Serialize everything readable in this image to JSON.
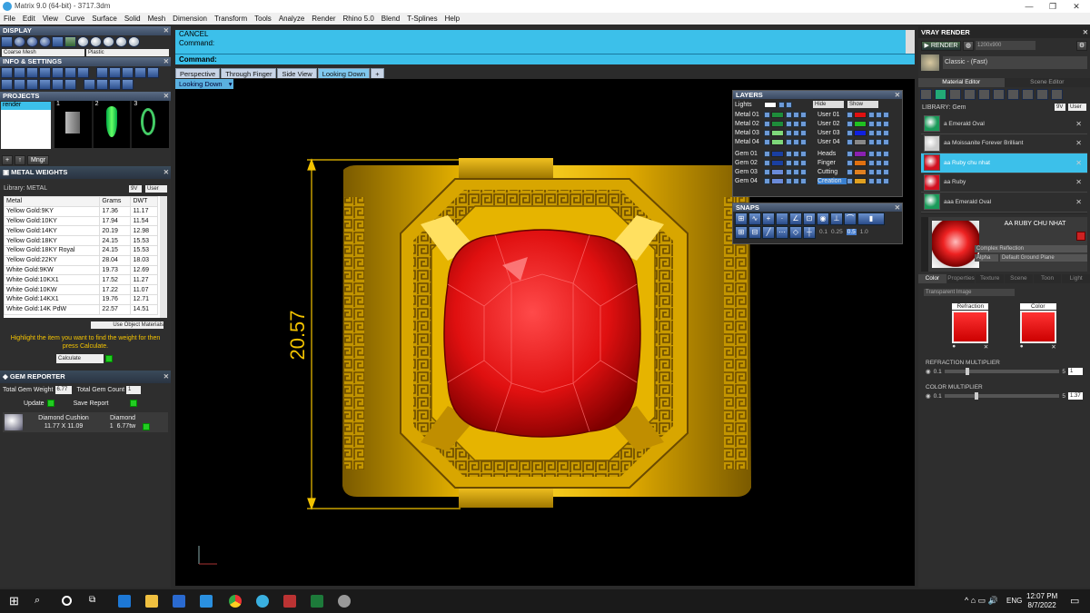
{
  "window": {
    "title": "Matrix 9.0 (64-bit) - 3717.3dm"
  },
  "menu": [
    "File",
    "Edit",
    "View",
    "Curve",
    "Surface",
    "Solid",
    "Mesh",
    "Dimension",
    "Transform",
    "Tools",
    "Analyze",
    "Render",
    "Rhino 5.0",
    "Blend",
    "T-Splines",
    "Help"
  ],
  "display": {
    "title": "DISPLAY",
    "left_select": "Coarse Mesh",
    "right_select": "Plastic"
  },
  "info": {
    "title": "INFO & SETTINGS"
  },
  "projects": {
    "title": "PROJECTS",
    "item": "render",
    "thumbs": [
      "1",
      "2",
      "3"
    ],
    "buttons": [
      "+",
      "↑",
      "Mngr"
    ]
  },
  "metal": {
    "title": "METAL WEIGHTS",
    "library": "Library: METAL",
    "headers": [
      "Metal",
      "Grams",
      "DWT"
    ],
    "rows": [
      [
        "Yellow Gold:9KY",
        "17.36",
        "11.17"
      ],
      [
        "Yellow Gold:10KY",
        "17.94",
        "11.54"
      ],
      [
        "Yellow Gold:14KY",
        "20.19",
        "12.98"
      ],
      [
        "Yellow Gold:18KY",
        "24.15",
        "15.53"
      ],
      [
        "Yellow Gold:18KY Royal",
        "24.15",
        "15.53"
      ],
      [
        "Yellow Gold:22KY",
        "28.04",
        "18.03"
      ],
      [
        "White Gold:9KW",
        "19.73",
        "12.69"
      ],
      [
        "White Gold:10KX1",
        "17.52",
        "11.27"
      ],
      [
        "White Gold:10KW",
        "17.22",
        "11.07"
      ],
      [
        "White Gold:14KX1",
        "19.76",
        "12.71"
      ],
      [
        "White Gold:14K PdW",
        "22.57",
        "14.51"
      ]
    ],
    "use_object": "Use Object Materials",
    "hint": "Highlight the item you want to find the weight for then press Calculate.",
    "calculate": "Calculate"
  },
  "gem": {
    "title": "GEM REPORTER",
    "total_weight_label": "Total Gem Weight",
    "total_weight": "6.77",
    "total_count_label": "Total Gem Count",
    "total_count": "1",
    "update": "Update",
    "save": "Save Report",
    "item_name": "Diamond Cushion",
    "item_type": "Diamond",
    "item_size": "11.77 X 11.09",
    "item_qty": "1",
    "item_weight": "6.77tw"
  },
  "command": {
    "cancel": "CANCEL",
    "line": "Command:",
    "prompt": "Command:"
  },
  "tabs": [
    "Perspective",
    "Through Finger",
    "Side View",
    "Looking Down"
  ],
  "viewport": {
    "label": "Looking Down",
    "dimension": "20.57"
  },
  "layers": {
    "title": "LAYERS",
    "lights": "Lights",
    "hide": "Hide",
    "show": "Show",
    "left": [
      [
        "Metal 01",
        "#1e8c3a"
      ],
      [
        "Metal 02",
        "#1e8c3a"
      ],
      [
        "Metal 03",
        "#7fd87a"
      ],
      [
        "Metal 04",
        "#7fd87a"
      ],
      [
        "Gem 01",
        "#1a3fa0"
      ],
      [
        "Gem 02",
        "#1a3fa0"
      ],
      [
        "Gem 03",
        "#6a8ad8"
      ],
      [
        "Gem 04",
        "#6a8ad8"
      ]
    ],
    "right": [
      [
        "User 01",
        "#e01010"
      ],
      [
        "User 02",
        "#20c020"
      ],
      [
        "User 03",
        "#1020e0"
      ],
      [
        "User 04",
        "#888888"
      ],
      [
        "Heads",
        "#8a20b0"
      ],
      [
        "Finger",
        "#e07010"
      ],
      [
        "Cutting",
        "#e08020"
      ],
      [
        "Creation",
        "#e0a020"
      ]
    ]
  },
  "snaps": {
    "title": "SNAPS",
    "values": [
      "0.1",
      "0.25",
      "0.5",
      "1.0"
    ]
  },
  "vray": {
    "title": "VRAY RENDER",
    "render": "RENDER",
    "size": "1200x900",
    "preset": "Classic - (Fast)",
    "tabs": [
      "Material Editor",
      "Scene Editor"
    ],
    "library": "LIBRARY: Gem",
    "materials": [
      "a Emerald Oval",
      "aa Moissanite Forever Brilliant",
      "aa Ruby chu nhat",
      "aa Ruby",
      "aaa Emerald Oval"
    ],
    "selected_name": "AA RUBY CHU NHAT",
    "type": "Complex Reflection",
    "alpha": "Alpha",
    "ground": "Default Ground Plane",
    "subtabs": [
      "Color",
      "Properties",
      "Texture",
      "Scene",
      "Toon",
      "Light"
    ],
    "transparent": "Transparent Image",
    "refraction": "Refraction",
    "color": "Color",
    "refraction_mult": "REFRACTION MULTIPLIER",
    "refraction_min": "0.1",
    "refraction_max": "5",
    "refraction_val": "1",
    "color_mult": "COLOR MULTIPLIER",
    "color_min": "0.1",
    "color_max": "5",
    "color_val": "1.37"
  },
  "taskbar": {
    "lang": "ENG",
    "time": "12:07 PM",
    "date": "8/7/2022"
  }
}
